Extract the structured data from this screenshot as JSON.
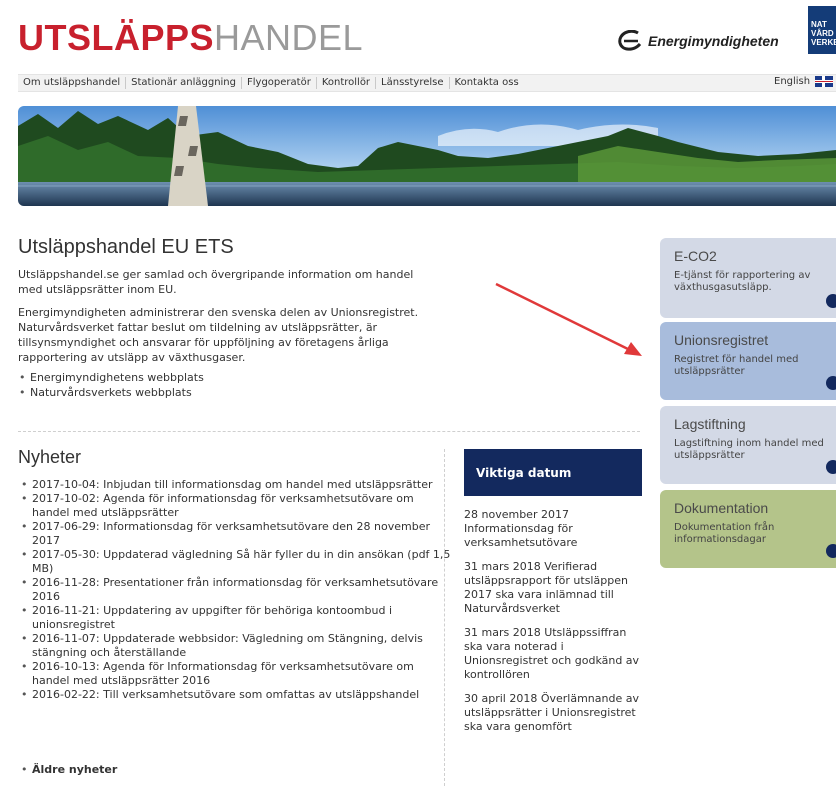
{
  "header": {
    "logo_bold": "UTSLÄPPS",
    "logo_light": "HANDEL",
    "partner_logo_text": "Energimyndigheten",
    "partner2_logo_text": "NAT VÅRD VERKE"
  },
  "topnav": {
    "items": [
      {
        "label": "Om utsläppshandel"
      },
      {
        "label": "Stationär anläggning"
      },
      {
        "label": "Flygoperatör"
      },
      {
        "label": "Kontrollör"
      },
      {
        "label": "Länsstyrelse"
      },
      {
        "label": "Kontakta oss"
      }
    ],
    "language": "English"
  },
  "main": {
    "title": "Utsläppshandel EU ETS",
    "intro": "Utsläppshandel.se ger samlad och övergripande information om handel med utsläppsrätter inom EU.",
    "body": "Energimyndigheten administrerar den svenska delen av Unionsregistret. Naturvårdsverket fattar beslut om tildelning av utsläppsrätter, är tillsynsmyndighet och ansvarar för uppföljning av företagens årliga rapportering av utsläpp av växthusgaser.",
    "links": [
      {
        "label": "Energimyndighetens webbplats"
      },
      {
        "label": "Naturvårdsverkets webbplats"
      }
    ]
  },
  "news": {
    "title": "Nyheter",
    "items": [
      {
        "text": "2017-10-04: Inbjudan till informationsdag om handel med utsläppsrätter"
      },
      {
        "text": "2017-10-02: Agenda för informationsdag för verksamhetsutövare om handel med utsläppsrätter"
      },
      {
        "text": "2017-06-29: Informationsdag för verksamhetsutövare den 28 november 2017"
      },
      {
        "text": "2017-05-30: Uppdaterad vägledning Så här fyller du in din ansökan (pdf 1,5 MB)"
      },
      {
        "text": "2016-11-28: Presentationer från informationsdag för verksamhetsutövare 2016"
      },
      {
        "text": "2016-11-21: Uppdatering av uppgifter för behöriga kontoombud i unionsregistret"
      },
      {
        "text": "2016-11-07: Uppdaterade webbsidor: Vägledning om Stängning, delvis stängning och återställande"
      },
      {
        "text": "2016-10-13: Agenda för Informationsdag för verksamhetsutövare om handel med utsläppsrätter 2016"
      },
      {
        "text": "2016-02-22: Till verksamhetsutövare som omfattas av utsläppshandel"
      }
    ],
    "older": "Äldre nyheter"
  },
  "dates": {
    "title": "Viktiga datum",
    "entries": [
      {
        "text": "28 november 2017 Informationsdag för verksamhetsutövare"
      },
      {
        "text": "31 mars 2018 Verifierad utsläppsrapport för utsläppen 2017 ska vara inlämnad till Naturvårdsverket"
      },
      {
        "text": "31 mars 2018 Utsläppssiffran ska vara noterad i Unionsregistret och godkänd av kontrollören"
      },
      {
        "text": "30 april 2018 Överlämnande av utsläppsrätter i Unionsregistret ska vara genomfört"
      }
    ]
  },
  "sidebar": {
    "boxes": [
      {
        "title": "E-CO2",
        "desc": "E-tjänst för rapportering av växthusgasutsläpp.",
        "color": "#d3d9e6"
      },
      {
        "title": "Unionsregistret",
        "desc": "Registret för handel med utsläppsrätter",
        "color": "#a8bcdc"
      },
      {
        "title": "Lagstiftning",
        "desc": "Lagstiftning inom handel med utsläppsrätter",
        "color": "#d3d9e6"
      },
      {
        "title": "Dokumentation",
        "desc": "Dokumentation från informationsdagar",
        "color": "#b4c48a"
      }
    ]
  },
  "colors": {
    "brand_red": "#c8202d",
    "navy": "#13295e",
    "annotation_arrow": "#e0393a"
  }
}
